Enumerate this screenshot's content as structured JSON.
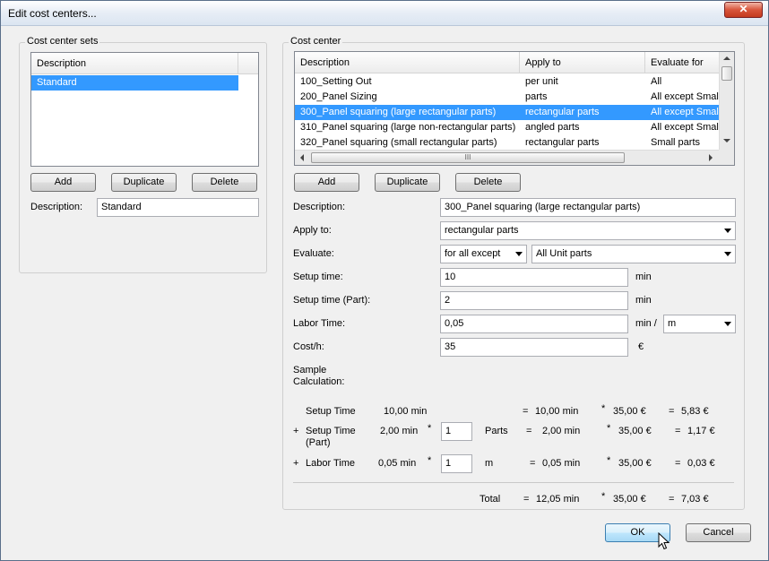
{
  "window": {
    "title": "Edit cost centers...",
    "close_glyph": "✕"
  },
  "sets": {
    "group_label": "Cost center sets",
    "column": "Description",
    "rows": [
      "Standard"
    ],
    "add": "Add",
    "duplicate": "Duplicate",
    "delete": "Delete",
    "description_label": "Description:",
    "description_value": "Standard"
  },
  "center": {
    "group_label": "Cost center",
    "columns": [
      "Description",
      "Apply to",
      "Evaluate for"
    ],
    "rows": [
      {
        "description": "100_Setting Out",
        "apply_to": "per unit",
        "evaluate_for": "All"
      },
      {
        "description": "200_Panel Sizing",
        "apply_to": "parts",
        "evaluate_for": "All except Small"
      },
      {
        "description": "300_Panel squaring (large rectangular parts)",
        "apply_to": "rectangular parts",
        "evaluate_for": "All except Small"
      },
      {
        "description": "310_Panel squaring (large non-rectangular parts)",
        "apply_to": "angled parts",
        "evaluate_for": "All except Small"
      },
      {
        "description": "320_Panel squaring (small rectangular parts)",
        "apply_to": "rectangular parts",
        "evaluate_for": "Small parts"
      }
    ],
    "add": "Add",
    "duplicate": "Duplicate",
    "delete": "Delete",
    "form": {
      "description_label": "Description:",
      "description_value": "300_Panel squaring (large rectangular parts)",
      "apply_label": "Apply to:",
      "apply_value": "rectangular parts",
      "evaluate_label": "Evaluate:",
      "evaluate_mode": "for all except",
      "evaluate_parts": "All Unit parts",
      "setup_label": "Setup time:",
      "setup_value": "10",
      "setup_unit": "min",
      "setup_part_label": "Setup time (Part):",
      "setup_part_value": "2",
      "setup_part_unit": "min",
      "labor_label": "Labor Time:",
      "labor_value": "0,05",
      "labor_unit": "min /",
      "labor_per": "m",
      "cost_label": "Cost/h:",
      "cost_value": "35",
      "cost_unit": "€"
    },
    "sample": {
      "label_line1": "Sample",
      "label_line2": "Calculation:",
      "row1": {
        "label": "Setup Time",
        "value": "10,00 min",
        "eq": "=",
        "time": "10,00 min",
        "mul": "*",
        "rate": "35,00 €",
        "eq2": "=",
        "result": "5,83 €"
      },
      "row2": {
        "plus": "+",
        "label_line1": "Setup Time",
        "label_line2": "(Part)",
        "value": "2,00 min",
        "mul1": "*",
        "qty": "1",
        "unit": "Parts",
        "eq": "=",
        "time": "2,00 min",
        "mul": "*",
        "rate": "35,00 €",
        "eq2": "=",
        "result": "1,17 €"
      },
      "row3": {
        "plus": "+",
        "label": "Labor Time",
        "value": "0,05 min",
        "mul1": "*",
        "qty": "1",
        "unit": "m",
        "eq": "=",
        "time": "0,05 min",
        "mul": "*",
        "rate": "35,00 €",
        "eq2": "=",
        "result": "0,03 €"
      },
      "total": {
        "label": "Total",
        "eq": "=",
        "time": "12,05 min",
        "mul": "*",
        "rate": "35,00 €",
        "eq2": "=",
        "result": "7,03 €"
      }
    }
  },
  "footer": {
    "ok": "OK",
    "cancel": "Cancel"
  },
  "scroll": {
    "grip": "III"
  },
  "colors": {
    "selection": "#3399ff"
  }
}
